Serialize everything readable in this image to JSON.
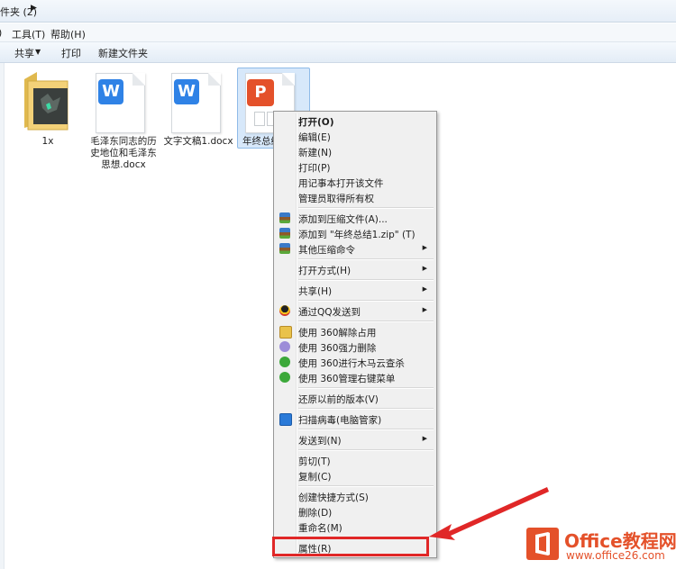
{
  "address": {
    "crumb": "件夹 (2)"
  },
  "menubar": {
    "items": [
      "工具(T)",
      "帮助(H)"
    ]
  },
  "toolbar": {
    "share": "共享",
    "print": "打印",
    "new_folder": "新建文件夹"
  },
  "files": [
    {
      "name": "1x",
      "type": "folder"
    },
    {
      "name_lines": [
        "毛泽东同志的历",
        "史地位和毛泽东",
        "思想.docx"
      ],
      "type": "docx",
      "badge": "W"
    },
    {
      "name": "文字文稿1.docx",
      "type": "docx",
      "badge": "W"
    },
    {
      "name": "年终总结1",
      "type": "pptx",
      "badge": "P",
      "selected": true
    }
  ],
  "context_menu": {
    "groups": [
      [
        "打开(O)",
        "编辑(E)",
        "新建(N)",
        "打印(P)",
        "用记事本打开该文件",
        "管理员取得所有权"
      ],
      [
        "添加到压缩文件(A)...",
        "添加到 \"年终总结1.zip\" (T)",
        "其他压缩命令"
      ],
      [
        "打开方式(H)"
      ],
      [
        "共享(H)"
      ],
      [
        "通过QQ发送到"
      ],
      [
        "使用 360解除占用",
        "使用 360强力删除",
        "使用 360进行木马云查杀",
        "使用 360管理右键菜单"
      ],
      [
        "还原以前的版本(V)"
      ],
      [
        "扫描病毒(电脑管家)"
      ],
      [
        "发送到(N)"
      ],
      [
        "剪切(T)",
        "复制(C)"
      ],
      [
        "创建快捷方式(S)",
        "删除(D)",
        "重命名(M)"
      ],
      [
        "属性(R)"
      ]
    ]
  },
  "logo": {
    "title": "Office教程网",
    "url": "www.office26.com"
  },
  "colors": {
    "accent": "#e02727",
    "word": "#2f82e6",
    "ppt": "#e4512a",
    "selection": "#d7e8fa"
  }
}
